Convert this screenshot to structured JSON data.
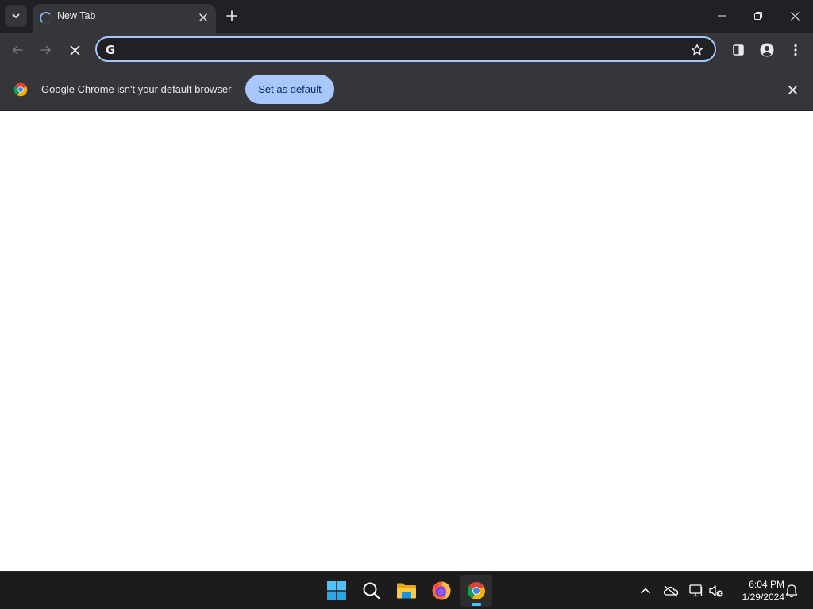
{
  "browser": {
    "tab": {
      "title": "New Tab"
    },
    "omnibox": {
      "value": "",
      "placeholder": ""
    },
    "infobar": {
      "message": "Google Chrome isn't your default browser",
      "button_label": "Set as default"
    },
    "colors": {
      "frame": "#202124",
      "toolbar": "#35363a",
      "accent": "#a8c7fa",
      "text": "#e8eaed"
    },
    "icons": {
      "tab_search": "chevron-down-icon",
      "loading": "loading-spinner-icon",
      "close": "close-icon",
      "new_tab": "plus-icon",
      "minimize": "minimize-icon",
      "restore": "restore-icon",
      "back": "arrow-left-icon",
      "forward": "arrow-right-icon",
      "stop": "stop-icon",
      "bookmark": "star-icon",
      "side_panel": "side-panel-icon",
      "profile": "profile-icon",
      "menu": "more-vertical-icon"
    }
  },
  "taskbar": {
    "apps": [
      "windows-start",
      "search",
      "file-explorer",
      "firefox",
      "chrome"
    ],
    "active_app": "chrome",
    "tray": [
      "chevron-up-icon",
      "onedrive-offline-icon",
      "network-icon",
      "volume-muted-icon",
      "notification-bell-icon"
    ],
    "clock": {
      "time": "6:04 PM",
      "date": "1/29/2024"
    },
    "accent": "#4cc2ff"
  }
}
